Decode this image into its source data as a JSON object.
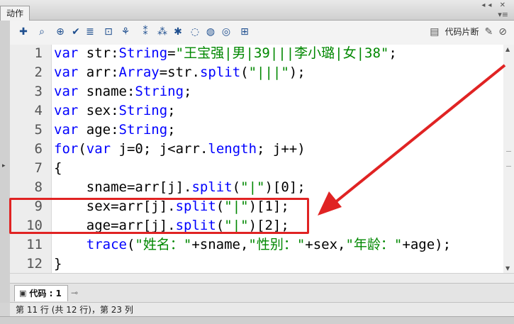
{
  "panel": {
    "tab_label": "动作"
  },
  "toolbar": {
    "icons": [
      "add-statement-icon",
      "find-icon",
      "target-icon",
      "check-syntax-icon",
      "auto-format-icon",
      "code-hint-icon",
      "debug-icon",
      "collapse-braces-icon",
      "collapse-selection-icon",
      "expand-all-icon",
      "comment-block-icon",
      "comment-line-icon",
      "uncomment-icon",
      "show-toolbox-icon"
    ],
    "snippets_label": "代码片断"
  },
  "editor": {
    "line_numbers": [
      "1",
      "2",
      "3",
      "4",
      "5",
      "6",
      "7",
      "8",
      "9",
      "10",
      "11",
      "12"
    ],
    "lines": [
      [
        {
          "t": "var",
          "c": "kw"
        },
        {
          "t": " str:",
          "c": ""
        },
        {
          "t": "String",
          "c": "ty"
        },
        {
          "t": "=",
          "c": ""
        },
        {
          "t": "\"王宝强|男|39|||李小璐|女|38\"",
          "c": "str"
        },
        {
          "t": ";",
          "c": ""
        }
      ],
      [
        {
          "t": "var",
          "c": "kw"
        },
        {
          "t": " arr:",
          "c": ""
        },
        {
          "t": "Array",
          "c": "ty"
        },
        {
          "t": "=str.",
          "c": ""
        },
        {
          "t": "split",
          "c": "fn"
        },
        {
          "t": "(",
          "c": ""
        },
        {
          "t": "\"|||\"",
          "c": "str"
        },
        {
          "t": ");",
          "c": ""
        }
      ],
      [
        {
          "t": "var",
          "c": "kw"
        },
        {
          "t": " sname:",
          "c": ""
        },
        {
          "t": "String",
          "c": "ty"
        },
        {
          "t": ";",
          "c": ""
        }
      ],
      [
        {
          "t": "var",
          "c": "kw"
        },
        {
          "t": " sex:",
          "c": ""
        },
        {
          "t": "String",
          "c": "ty"
        },
        {
          "t": ";",
          "c": ""
        }
      ],
      [
        {
          "t": "var",
          "c": "kw"
        },
        {
          "t": " age:",
          "c": ""
        },
        {
          "t": "String",
          "c": "ty"
        },
        {
          "t": ";",
          "c": ""
        }
      ],
      [
        {
          "t": "for",
          "c": "kw"
        },
        {
          "t": "(",
          "c": ""
        },
        {
          "t": "var",
          "c": "kw"
        },
        {
          "t": " j=0; j<arr.",
          "c": ""
        },
        {
          "t": "length",
          "c": "fn"
        },
        {
          "t": "; j++)",
          "c": ""
        }
      ],
      [
        {
          "t": "{",
          "c": ""
        }
      ],
      [
        {
          "t": "    sname=arr[j].",
          "c": ""
        },
        {
          "t": "split",
          "c": "fn"
        },
        {
          "t": "(",
          "c": ""
        },
        {
          "t": "\"|\"",
          "c": "str"
        },
        {
          "t": ")[0];",
          "c": ""
        }
      ],
      [
        {
          "t": "    sex=arr[j].",
          "c": ""
        },
        {
          "t": "split",
          "c": "fn"
        },
        {
          "t": "(",
          "c": ""
        },
        {
          "t": "\"|\"",
          "c": "str"
        },
        {
          "t": ")[1];",
          "c": ""
        }
      ],
      [
        {
          "t": "    age=arr[j].",
          "c": ""
        },
        {
          "t": "split",
          "c": "fn"
        },
        {
          "t": "(",
          "c": ""
        },
        {
          "t": "\"|\"",
          "c": "str"
        },
        {
          "t": ")[2];",
          "c": ""
        }
      ],
      [
        {
          "t": "    ",
          "c": ""
        },
        {
          "t": "trace",
          "c": "fn"
        },
        {
          "t": "(",
          "c": ""
        },
        {
          "t": "\"姓名：\"",
          "c": "str"
        },
        {
          "t": "+sname,",
          "c": ""
        },
        {
          "t": "\"性别：\"",
          "c": "str"
        },
        {
          "t": "+sex,",
          "c": ""
        },
        {
          "t": "\"年龄：\"",
          "c": "str"
        },
        {
          "t": "+age);",
          "c": ""
        }
      ],
      [
        {
          "t": "}",
          "c": ""
        }
      ]
    ]
  },
  "tabs": {
    "code_tab_label": "代码 : 1"
  },
  "status": {
    "text": "第 11 行 (共 12 行)，第 23 列"
  },
  "colors": {
    "highlight": "#e02323",
    "keyword": "#0000ff",
    "string": "#008800"
  }
}
